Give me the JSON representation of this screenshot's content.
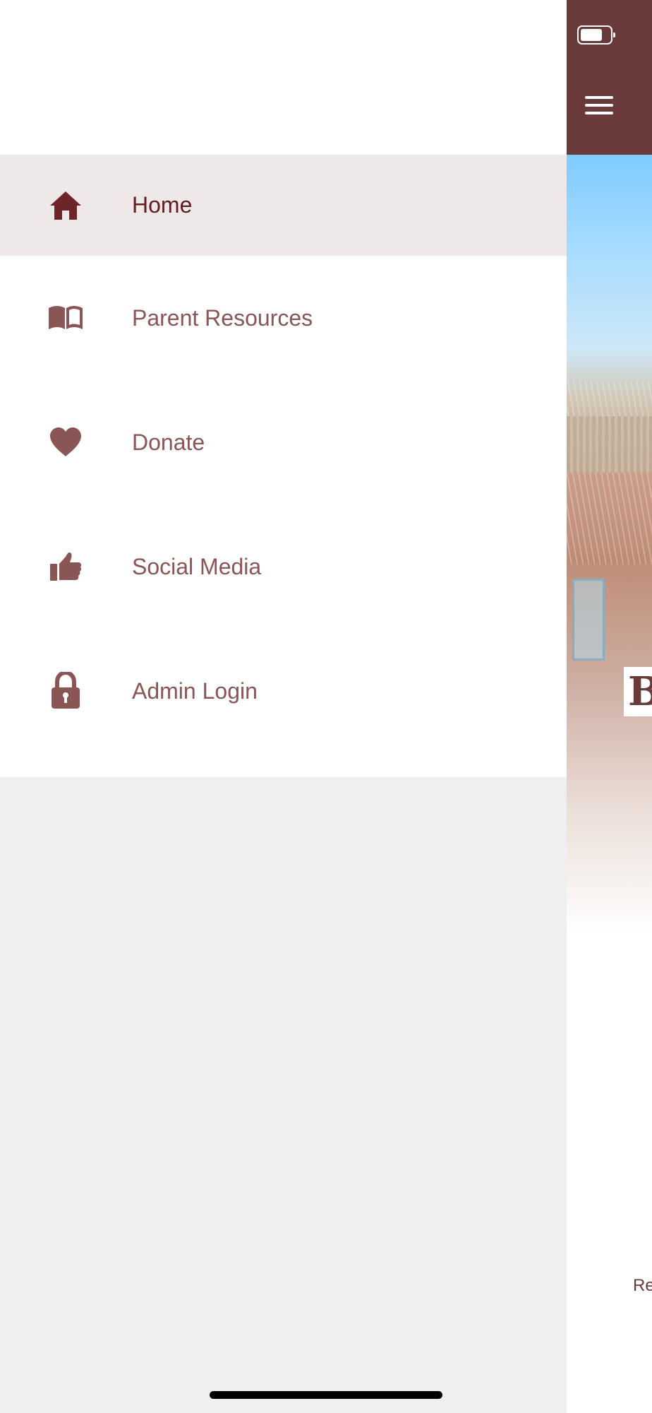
{
  "drawer": {
    "items": [
      {
        "label": "Home",
        "icon": "home-icon",
        "active": true
      },
      {
        "label": "Parent Resources",
        "icon": "book-icon",
        "active": false
      },
      {
        "label": "Donate",
        "icon": "heart-icon",
        "active": false
      },
      {
        "label": "Social Media",
        "icon": "thumbs-up-icon",
        "active": false
      },
      {
        "label": "Admin Login",
        "icon": "lock-icon",
        "active": false
      }
    ]
  },
  "background_app": {
    "header_icons": [
      "battery-icon",
      "hamburger-menu-icon"
    ],
    "hero_letter": "B",
    "bottom_text": "Re"
  },
  "colors": {
    "brand": "#5e2929",
    "active_item_bg": "#efe8e9",
    "active_text": "#5e1f22",
    "inactive_text": "#8a5555",
    "active_icon": "#6e2528",
    "inactive_icon": "#8a5555",
    "drawer_bg": "#f0eff0"
  }
}
